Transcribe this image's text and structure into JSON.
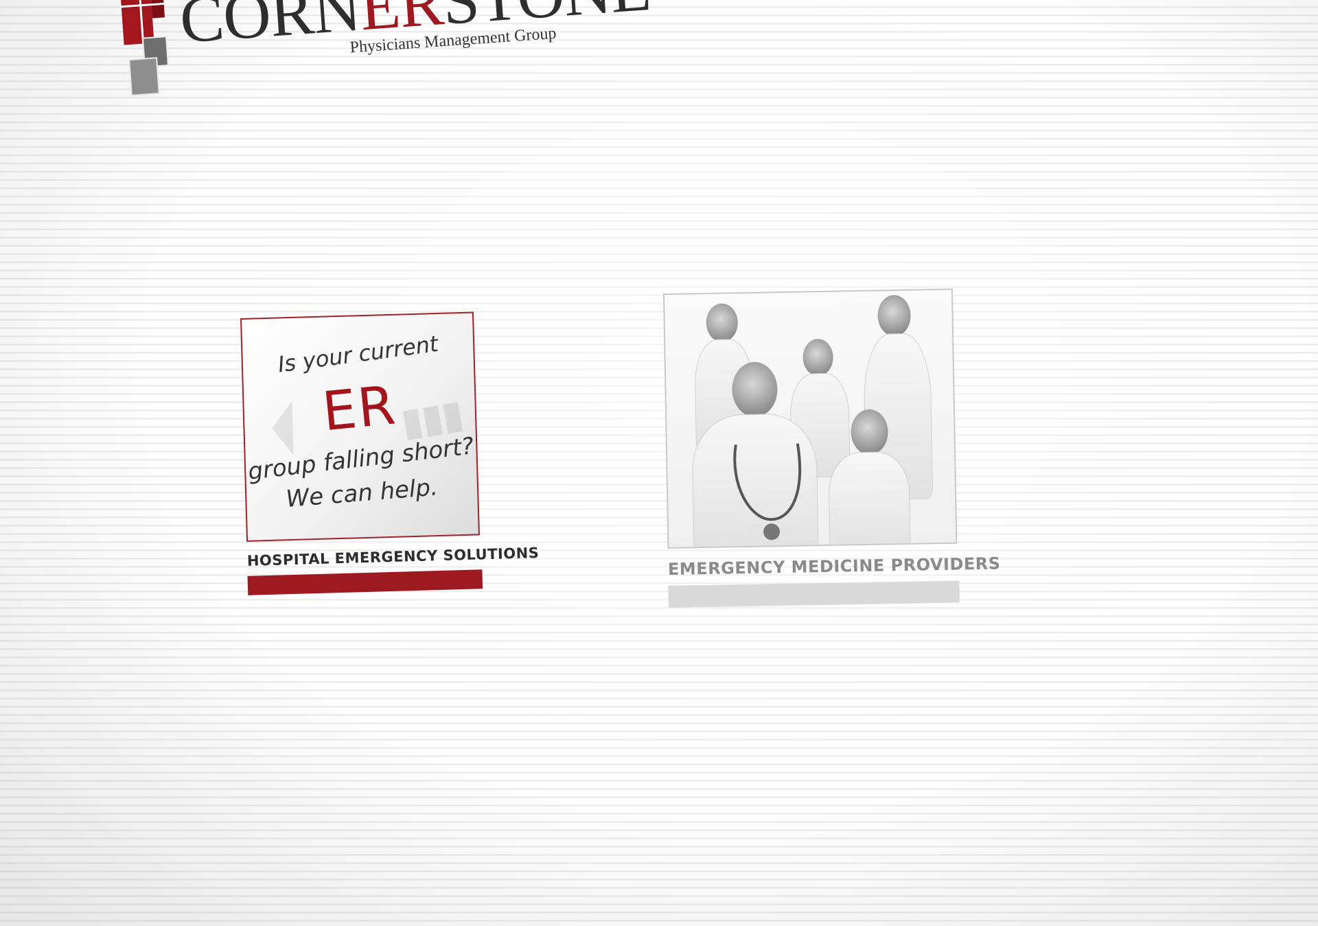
{
  "brand": {
    "name_part1": "CORN",
    "name_part2": "ER",
    "name_part3": "STONE",
    "tagline": "Physicians Management Group",
    "accent_color": "#9c1a20",
    "gray_color": "#8a8a8a"
  },
  "cards": [
    {
      "image_text": {
        "line1": "Is your current",
        "line2": "ER",
        "line3": "group falling short?",
        "line4": "We can help."
      },
      "label": "HOSPITAL EMERGENCY SOLUTIONS",
      "bar_color": "#9c1a20"
    },
    {
      "image_alt": "photo-of-medical-team",
      "label": "EMERGENCY MEDICINE PROVIDERS",
      "bar_color": "#d9d9d9"
    }
  ]
}
